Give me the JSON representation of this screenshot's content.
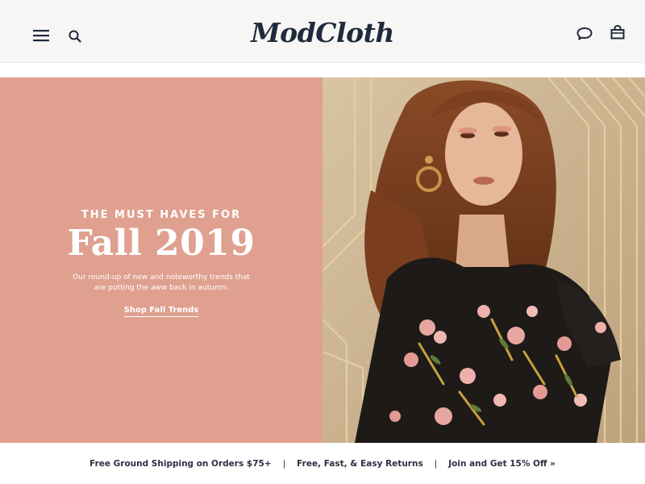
{
  "header": {
    "logo": "ModCloth",
    "icons": [
      "menu-icon",
      "search-icon",
      "chat-icon",
      "shopping-bag-icon"
    ]
  },
  "hero": {
    "eyebrow": "THE MUST HAVES FOR",
    "headline": "Fall 2019",
    "desc_part1": "Our round-up of new and noteworthy trends that are putting the ",
    "desc_emphasis": "aww",
    "desc_part2": " back in autumn.",
    "cta": "Shop Fall Trends",
    "colors": {
      "panel": "#e0a08f",
      "text": "#ffffff"
    }
  },
  "promo": {
    "item1": "Free Ground Shipping on Orders $75+",
    "item2": "Free, Fast, & Easy Returns",
    "item3": "Join and Get 15% Off »",
    "separator": "|"
  }
}
